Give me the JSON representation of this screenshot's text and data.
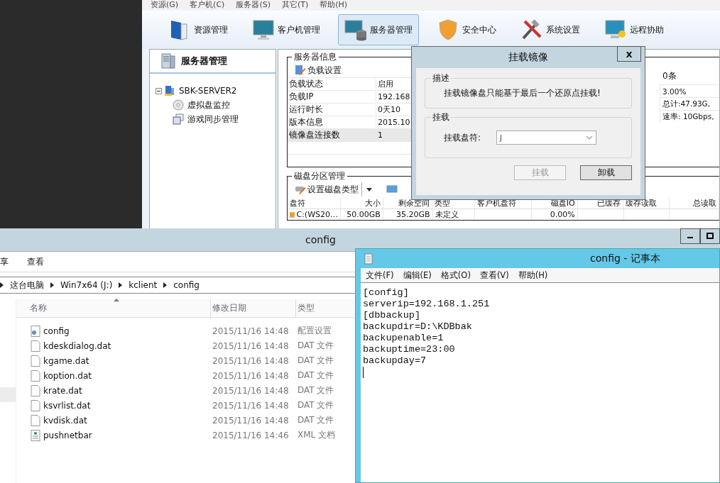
{
  "server_app": {
    "menu": [
      "资源(G)",
      "客户机(C)",
      "服务器(S)",
      "其它(T)",
      "帮助(H)"
    ],
    "toolbar": [
      {
        "label": "资源管理",
        "selected": false
      },
      {
        "label": "客户机管理",
        "selected": false
      },
      {
        "label": "服务器管理",
        "selected": true
      },
      {
        "label": "安全中心",
        "selected": false
      },
      {
        "label": "系统设置",
        "selected": false
      },
      {
        "label": "远程协助",
        "selected": false
      }
    ],
    "sidebar": {
      "title": "服务器管理",
      "tree": [
        {
          "label": "SBK-SERVER2",
          "expanded": true,
          "children": [
            {
              "label": "虚拟盘监控"
            },
            {
              "label": "游戏同步管理"
            }
          ]
        }
      ]
    },
    "server_info": {
      "title": "服务器信息",
      "button": "负载设置",
      "rows": [
        {
          "label": "负载状态",
          "value": "启用",
          "selected": false
        },
        {
          "label": "负载IP",
          "value": "192.168",
          "selected": false
        },
        {
          "label": "运行时长",
          "value": "0天10",
          "selected": false
        },
        {
          "label": "版本信息",
          "value": "2015.10",
          "selected": false
        },
        {
          "label": "镜像盘连接数",
          "value": "1",
          "selected": true
        }
      ],
      "side_header": "0条",
      "side_values": [
        "3.00%",
        "总计:47.93G,",
        "速率: 10Gbps,"
      ]
    },
    "disk_partition": {
      "title": "磁盘分区管理",
      "button": "设置磁盘类型",
      "columns": [
        "盘符",
        "大小",
        "剩余空间",
        "类型",
        "客户机盘符",
        "磁盘IO",
        "已缓存",
        "缓存读取",
        "总读取"
      ],
      "rows": [
        [
          "C:(WS20…",
          "50.00GB",
          "35.20GB",
          "未定义",
          "",
          "0.00%",
          "",
          "",
          ""
        ]
      ]
    }
  },
  "dialog": {
    "title": "挂载镜像",
    "close": "x",
    "description_title": "描述",
    "description": "挂载镜像盘只能基于最后一个还原点挂载!",
    "mount_title": "挂载",
    "drive_label": "挂载盘符:",
    "drive_value": "J",
    "buttons": [
      {
        "label": "挂载",
        "disabled": true
      },
      {
        "label": "卸载",
        "disabled": false
      }
    ]
  },
  "explorer": {
    "title": "config",
    "ribbon_tabs": [
      "享",
      "查看"
    ],
    "breadcrumb": [
      "这台电脑",
      "Win7x64 (J:)",
      "kclient",
      "config"
    ],
    "columns": [
      "名称",
      "修改日期",
      "类型"
    ],
    "files": [
      {
        "name": "config",
        "date": "2015/11/16 14:48",
        "type": "配置设置",
        "kind": "settings"
      },
      {
        "name": "kdeskdialog.dat",
        "date": "2015/11/16 14:48",
        "type": "DAT 文件",
        "kind": "file"
      },
      {
        "name": "kgame.dat",
        "date": "2015/11/16 14:48",
        "type": "DAT 文件",
        "kind": "file"
      },
      {
        "name": "koption.dat",
        "date": "2015/11/16 14:48",
        "type": "DAT 文件",
        "kind": "file"
      },
      {
        "name": "krate.dat",
        "date": "2015/11/16 14:48",
        "type": "DAT 文件",
        "kind": "file"
      },
      {
        "name": "ksvrlist.dat",
        "date": "2015/11/16 14:48",
        "type": "DAT 文件",
        "kind": "file"
      },
      {
        "name": "kvdisk.dat",
        "date": "2015/11/16 14:48",
        "type": "DAT 文件",
        "kind": "file"
      },
      {
        "name": "pushnetbar",
        "date": "2015/11/16 14:46",
        "type": "XML 文档",
        "kind": "xml"
      }
    ]
  },
  "notepad": {
    "title": "config - 记事本",
    "menu": [
      "文件(F)",
      "编辑(E)",
      "格式(O)",
      "查看(V)",
      "帮助(H)"
    ],
    "lines": [
      "[config]",
      "serverip=192.168.1.251",
      "[dbbackup]",
      "backupdir=D:\\KDBbak",
      "backupenable=1",
      "backuptime=23:00",
      "backupday=7"
    ]
  }
}
